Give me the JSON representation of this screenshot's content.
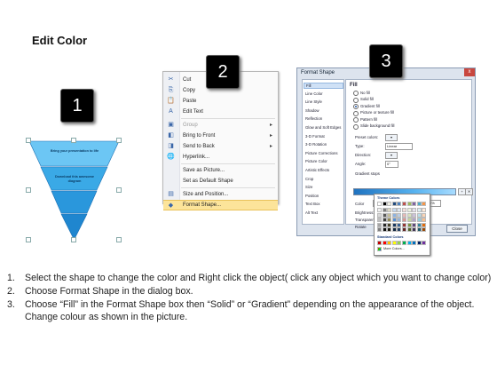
{
  "title": "Edit Color",
  "steps_badges": [
    "1",
    "2",
    "3"
  ],
  "panel1": {
    "funnel_texts": [
      "Bring your presentation to life",
      "Download this awesome diagram"
    ],
    "colors": {
      "top": "#57b8ee",
      "mid": "#2a9de0",
      "bottom": "#1f8ad2"
    }
  },
  "menu": {
    "items": [
      {
        "label": "Cut",
        "icon": "scissors-icon",
        "glyph": "✂",
        "disabled": false
      },
      {
        "label": "Copy",
        "icon": "copy-icon",
        "glyph": "⎘",
        "disabled": false
      },
      {
        "label": "Paste",
        "icon": "paste-icon",
        "glyph": "📋",
        "disabled": false
      },
      {
        "label": "Edit Text",
        "icon": "edit-text-icon",
        "glyph": "A",
        "disabled": false
      },
      {
        "label": "Group",
        "icon": "group-icon",
        "glyph": "▣",
        "disabled": true,
        "submenu": true
      },
      {
        "label": "Bring to Front",
        "icon": "bring-front-icon",
        "glyph": "◧",
        "disabled": false,
        "submenu": true
      },
      {
        "label": "Send to Back",
        "icon": "send-back-icon",
        "glyph": "◨",
        "disabled": false,
        "submenu": true
      },
      {
        "label": "Hyperlink...",
        "icon": "hyperlink-icon",
        "glyph": "🌐",
        "disabled": false
      },
      {
        "label": "Save as Picture...",
        "icon": "",
        "glyph": "",
        "disabled": false
      },
      {
        "label": "Set as Default Shape",
        "icon": "",
        "glyph": "",
        "disabled": false
      },
      {
        "label": "Size and Position...",
        "icon": "size-position-icon",
        "glyph": "▤",
        "disabled": false
      },
      {
        "label": "Format Shape...",
        "icon": "format-shape-icon",
        "glyph": "◆",
        "disabled": false,
        "highlight": true
      }
    ]
  },
  "dialog": {
    "title": "Format Shape",
    "close": "x",
    "categories": [
      "Fill",
      "Line Color",
      "Line Style",
      "Shadow",
      "Reflection",
      "Glow and Soft Edges",
      "3-D Format",
      "3-D Rotation",
      "Picture Corrections",
      "Picture Color",
      "Artistic Effects",
      "Crop",
      "Size",
      "Position",
      "Text Box",
      "Alt Text"
    ],
    "selected_category": "Fill",
    "fill_heading": "Fill",
    "fill_options": [
      "No fill",
      "Solid fill",
      "Gradient fill",
      "Picture or texture fill",
      "Pattern fill",
      "Slide background fill"
    ],
    "selected_fill": "Gradient fill",
    "preset_label": "Preset colors:",
    "type_label": "Type:",
    "type_value": "Linear",
    "direction_label": "Direction:",
    "angle_label": "Angle:",
    "angle_value": "0°",
    "gradient_stops_label": "Gradient stops",
    "color_label": "Color",
    "position_label": "Position:",
    "position_value": "0%",
    "brightness_label": "Brightness:",
    "transparency_label": "Transparen",
    "rotate_label": "Rotate",
    "theme_colors_label": "Theme Colors",
    "standard_colors_label": "Standard Colors",
    "more_colors_label": "More Colors...",
    "close_button": "Close",
    "theme_top_row": [
      "#ffffff",
      "#000000",
      "#eeece1",
      "#1f497d",
      "#4f81bd",
      "#c0504d",
      "#9bbb59",
      "#8064a2",
      "#4bacc6",
      "#f79646"
    ],
    "theme_shade_rows": [
      [
        "#f2f2f2",
        "#7f7f7f",
        "#ddd9c3",
        "#c6d9f0",
        "#dbe5f1",
        "#f2dcdb",
        "#ebf1dd",
        "#e5e0ec",
        "#dbeef3",
        "#fdeada"
      ],
      [
        "#d8d8d8",
        "#595959",
        "#c4bd97",
        "#8db3e2",
        "#b8cce4",
        "#e5b9b7",
        "#d7e3bc",
        "#ccc1d9",
        "#b7dde8",
        "#fbd5b5"
      ],
      [
        "#bfbfbf",
        "#3f3f3f",
        "#938953",
        "#548dd4",
        "#95b3d7",
        "#d99694",
        "#c3d69b",
        "#b2a2c7",
        "#92cddc",
        "#fac08f"
      ],
      [
        "#a5a5a5",
        "#262626",
        "#494429",
        "#17365d",
        "#366092",
        "#953734",
        "#76923c",
        "#5f497a",
        "#31859b",
        "#e36c09"
      ],
      [
        "#7f7f7f",
        "#0c0c0c",
        "#1d1b10",
        "#0f243e",
        "#244061",
        "#632423",
        "#4f6128",
        "#3f3151",
        "#205867",
        "#974806"
      ]
    ],
    "standard_colors": [
      "#c00000",
      "#ff0000",
      "#ffc000",
      "#ffff00",
      "#92d050",
      "#00b050",
      "#00b0f0",
      "#0070c0",
      "#002060",
      "#7030a0"
    ]
  },
  "instructions": [
    {
      "num": "1.",
      "text": "Select the shape to change the color and Right click the object( click any object which you want to change color)"
    },
    {
      "num": "2.",
      "text": "Choose Format Shape in the dialog box."
    },
    {
      "num": "3.",
      "text": "Choose “Fill” in the Format Shape box then “Solid” or “Gradient” depending on the appearance of the object. Change colour as shown in the picture."
    }
  ]
}
